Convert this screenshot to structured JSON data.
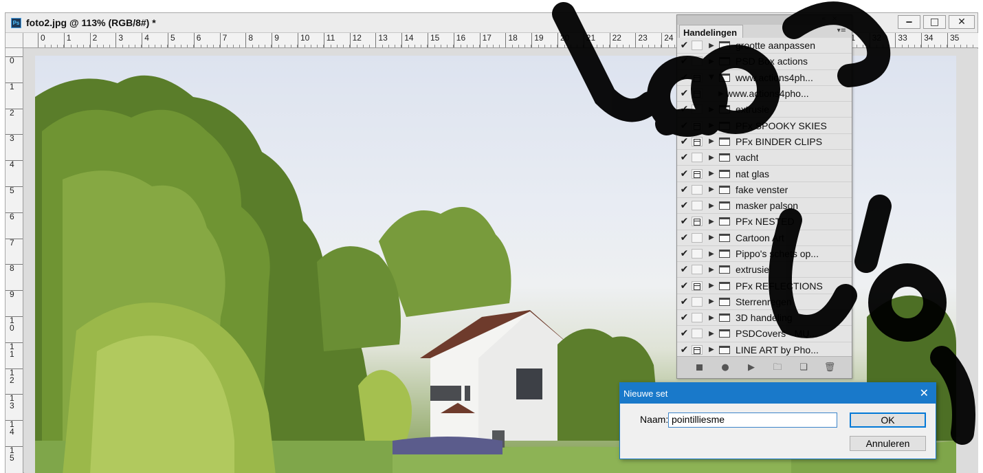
{
  "document": {
    "app_icon_text": "Ps",
    "title": "foto2.jpg @ 113% (RGB/8#) *",
    "window_buttons": {
      "minimize": "‒",
      "maximize": "□",
      "close": "✕"
    }
  },
  "ruler": {
    "horizontal": [
      "0",
      "1",
      "2",
      "3",
      "4",
      "5",
      "6",
      "7",
      "8",
      "9",
      "10",
      "11",
      "12",
      "13",
      "14",
      "15",
      "16",
      "17",
      "18",
      "19",
      "20",
      "21",
      "22",
      "23",
      "24",
      "25",
      "26",
      "27",
      "28",
      "29",
      "30",
      "31",
      "32",
      "33",
      "34",
      "35"
    ],
    "vertical": [
      "0",
      "1",
      "2",
      "3",
      "4",
      "5",
      "6",
      "7",
      "8",
      "9",
      "10",
      "11",
      "12",
      "13",
      "14",
      "15"
    ]
  },
  "actions_panel": {
    "tab_label": "Handelingen",
    "collapse_glyph": "«",
    "close_glyph": "×",
    "menu_glyph": "▾≡",
    "items": [
      {
        "name": "grootte aanpassen",
        "checked": true,
        "dialog": false,
        "expanded": false,
        "kind": "set"
      },
      {
        "name": "PSD Box actions",
        "checked": true,
        "dialog": false,
        "expanded": false,
        "kind": "set"
      },
      {
        "name": "www.actions4ph...",
        "checked": true,
        "dialog": true,
        "expanded": true,
        "kind": "set"
      },
      {
        "name": "www.actions4pho...",
        "checked": true,
        "dialog": true,
        "expanded": false,
        "kind": "action"
      },
      {
        "name": "extrusie",
        "checked": true,
        "dialog": false,
        "expanded": false,
        "kind": "set"
      },
      {
        "name": "PFx SPOOKY SKIES",
        "checked": true,
        "dialog": true,
        "expanded": false,
        "kind": "set"
      },
      {
        "name": "PFx BINDER CLIPS",
        "checked": true,
        "dialog": true,
        "expanded": false,
        "kind": "set"
      },
      {
        "name": "vacht",
        "checked": true,
        "dialog": false,
        "expanded": false,
        "kind": "set"
      },
      {
        "name": "nat glas",
        "checked": true,
        "dialog": true,
        "expanded": false,
        "kind": "set"
      },
      {
        "name": "fake venster",
        "checked": true,
        "dialog": false,
        "expanded": false,
        "kind": "set"
      },
      {
        "name": "masker palson",
        "checked": true,
        "dialog": false,
        "expanded": false,
        "kind": "set"
      },
      {
        "name": "PFx NESTED",
        "checked": true,
        "dialog": true,
        "expanded": false,
        "kind": "set"
      },
      {
        "name": "Cartoon Art",
        "checked": true,
        "dialog": false,
        "expanded": false,
        "kind": "set"
      },
      {
        "name": "Pippo's schets op...",
        "checked": true,
        "dialog": false,
        "expanded": false,
        "kind": "set"
      },
      {
        "name": "extrusie",
        "checked": true,
        "dialog": false,
        "expanded": false,
        "kind": "set"
      },
      {
        "name": "PFx REFLECTIONS",
        "checked": true,
        "dialog": true,
        "expanded": false,
        "kind": "set"
      },
      {
        "name": "Sterrenregen",
        "checked": true,
        "dialog": false,
        "expanded": false,
        "kind": "set"
      },
      {
        "name": "3D handeling",
        "checked": true,
        "dialog": false,
        "expanded": false,
        "kind": "set"
      },
      {
        "name": "PSDCovers - MU...",
        "checked": true,
        "dialog": false,
        "expanded": false,
        "kind": "set"
      },
      {
        "name": "LINE ART by Pho...",
        "checked": true,
        "dialog": true,
        "expanded": false,
        "kind": "set"
      }
    ],
    "glyphs": {
      "check": "✔",
      "collapsed": "▶",
      "expanded": "▼"
    },
    "bottom_icons": [
      "stop-icon",
      "record-icon",
      "play-icon",
      "new-set-icon",
      "new-action-icon",
      "delete-icon"
    ]
  },
  "dialog": {
    "title": "Nieuwe set",
    "close_glyph": "✕",
    "name_label": "Naam:",
    "name_value": "pointilliesme",
    "ok_label": "OK",
    "cancel_label": "Annuleren"
  }
}
